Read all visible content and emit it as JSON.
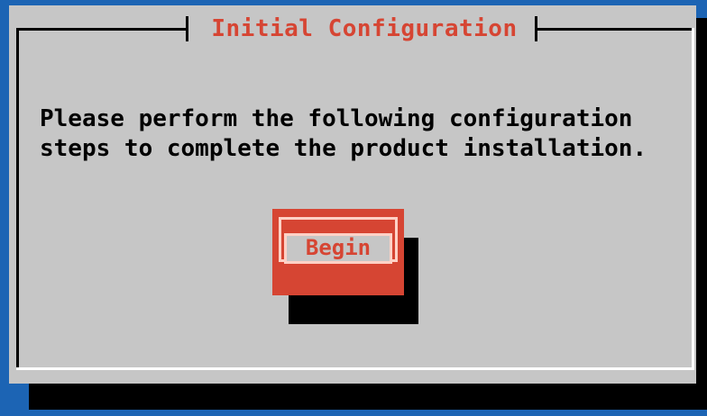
{
  "dialog": {
    "title": "Initial Configuration",
    "message_line_1": "Please perform the following configuration",
    "message_line_2": "steps to complete the product installation.",
    "begin_button_label": "Begin"
  },
  "colors": {
    "background": "#1c64b4",
    "dialog": "#c6c6c6",
    "accent": "#d64533"
  }
}
